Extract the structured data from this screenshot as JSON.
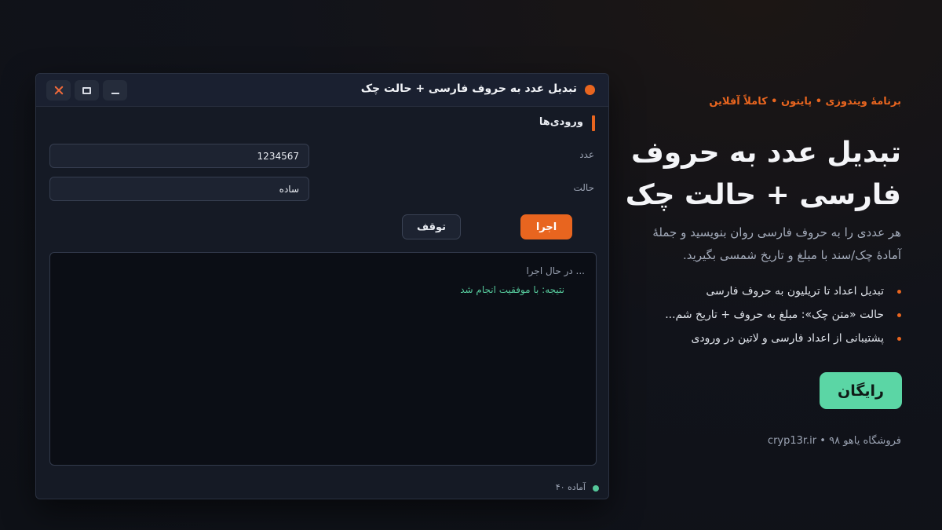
{
  "window": {
    "title": "تبدیل عدد به حروف فارسی + حالت چک",
    "controls": {
      "close": "close-icon",
      "maximize": "maximize-icon",
      "minimize": "minimize-icon"
    },
    "section_title": "ورودی‌ها",
    "fields": {
      "number": {
        "label": "عدد",
        "value": "1234567"
      },
      "mode": {
        "label": "حالت",
        "value": "ساده"
      }
    },
    "buttons": {
      "run": "اجرا",
      "stop": "توقف"
    },
    "log": [
      "... در حال اجرا",
      "نتیجه: با موفقیت انجام شد"
    ],
    "status": "آماده ۴۰"
  },
  "marketing": {
    "eyebrow": "برنامهٔ ویندوزی • پایتون • کاملاً آفلاین",
    "title_line1": "تبدیل عدد به حروف",
    "title_line2": "فارسی + حالت چک",
    "desc_line1": "هر عددی را به حروف فارسی روان بنویسید و جملهٔ",
    "desc_line2": "آمادهٔ چک/سند با مبلغ و تاریخ شمسی بگیرید.",
    "features": [
      "تبدیل اعداد تا تریلیون به حروف فارسی",
      "حالت «متن چک»: مبلغ به حروف + تاریخ شم...",
      "پشتیبانی از اعداد فارسی و لاتین در ورودی"
    ],
    "cta": "رایگان",
    "footer": "فروشگاه یاهو ۹۸ • cryp13r.ir"
  },
  "colors": {
    "accent": "#e8651f",
    "success": "#55c79a",
    "cta": "#5bd6a5",
    "window_bg": "#151a25",
    "page_bg": "#11131a"
  }
}
